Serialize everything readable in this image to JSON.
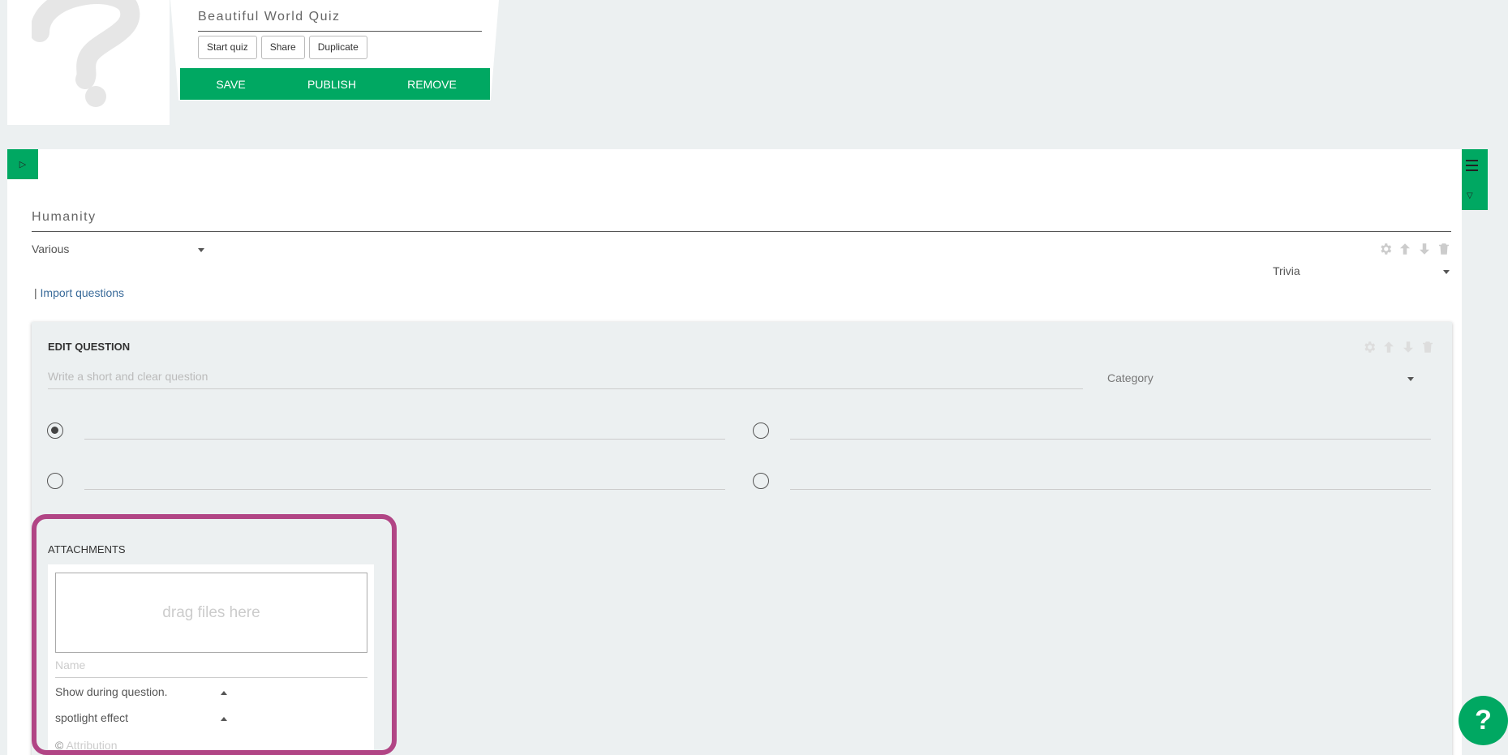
{
  "quiz": {
    "title": "Beautiful World Quiz",
    "buttons": {
      "start": "Start quiz",
      "share": "Share",
      "duplicate": "Duplicate"
    },
    "actions": {
      "save": "SAVE",
      "publish": "PUBLISH",
      "remove": "REMOVE"
    }
  },
  "round": {
    "title": "Humanity",
    "category_select": "Various",
    "type_select": "Trivia",
    "import_prefix": "|",
    "import_link": "Import questions"
  },
  "edit_question": {
    "heading": "EDIT QUESTION",
    "question_placeholder": "Write a short and clear question",
    "category_placeholder": "Category",
    "answers": [
      {
        "selected": true,
        "value": ""
      },
      {
        "selected": false,
        "value": ""
      },
      {
        "selected": false,
        "value": ""
      },
      {
        "selected": false,
        "value": ""
      }
    ],
    "attachments": {
      "heading": "ATTACHMENTS",
      "dropzone_text": "drag files here",
      "name_placeholder": "Name",
      "show_mode": "Show during question.",
      "effect": "spotlight effect",
      "attribution_prefix": "©",
      "attribution_placeholder": "Attribution"
    }
  },
  "help_button": "?",
  "colors": {
    "accent": "#00a862",
    "highlight": "#b14585",
    "background": "#ecf0f1",
    "link": "#3a6b9a"
  },
  "icons": [
    "question-mark-logo",
    "play-toggle-icon",
    "menu-icon",
    "triangle-down-icon",
    "gear-icon",
    "arrow-up-icon",
    "arrow-down-icon",
    "trash-icon",
    "caret-down-icon",
    "caret-up-icon"
  ]
}
